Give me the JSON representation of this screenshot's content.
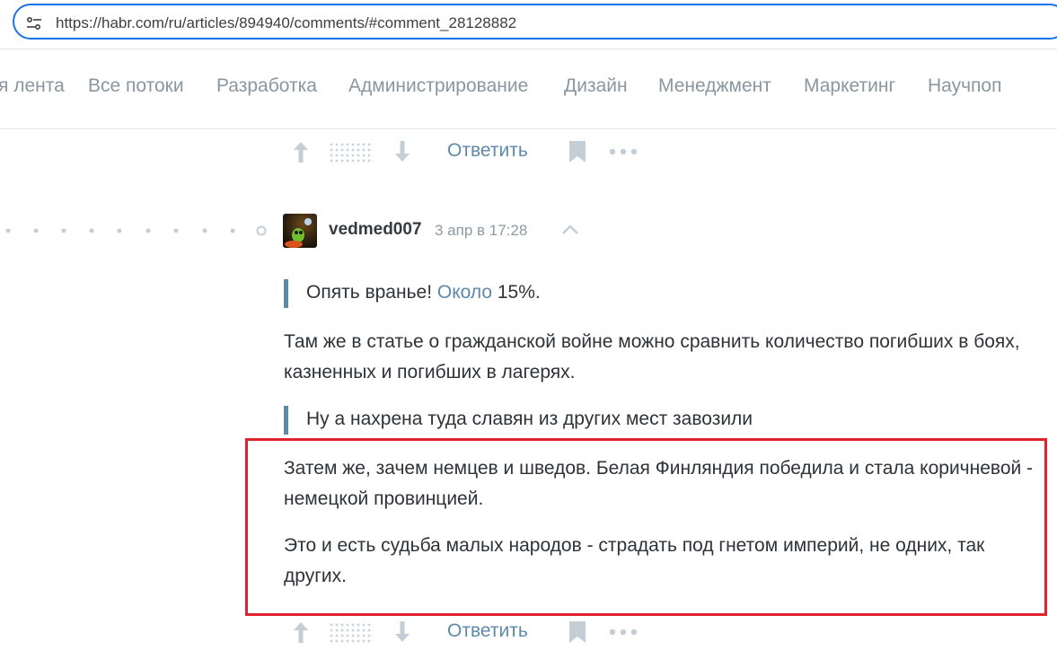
{
  "browser": {
    "url": "https://habr.com/ru/articles/894940/comments/#comment_28128882",
    "site_info_icon": "site-settings-icon"
  },
  "nav": {
    "items": [
      "я лента",
      "Все потоки",
      "Разработка",
      "Администрирование",
      "Дизайн",
      "Менеджмент",
      "Маркетинг",
      "Научпоп"
    ]
  },
  "actions": {
    "reply_label": "Ответить",
    "upvote_icon": "arrow-up-icon",
    "downvote_icon": "arrow-down-icon",
    "bookmark_icon": "bookmark-icon",
    "more_icon": "more-dots-icon"
  },
  "comment": {
    "username": "vedmed007",
    "timestamp": "3 апр в 17:28",
    "quote1": {
      "before": "Опять вранье! ",
      "link": "Около",
      "after": " 15%."
    },
    "para1": "Там же в статье о гражданской войне можно сравнить количество погибших в боях, казненных и погибших в лагерях.",
    "quote2": "Ну а нахрена туда славян из других мест завозили",
    "para2": "Затем же, зачем немцев и шведов. Белая Финляндия победила и стала коричневой - немецкой провинцией.",
    "para3": "Это и есть судьба малых народов - страдать под гнетом империй, не одних, так других."
  },
  "colors": {
    "accent": "#5e8aa8",
    "nav_text": "#8a96a0",
    "highlight_border": "#e0232e",
    "url_border": "#1a73e8"
  }
}
